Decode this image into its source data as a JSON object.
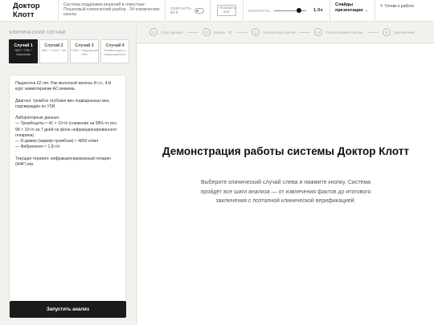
{
  "header": {
    "logo": "Доктор Клотт",
    "subtitle": "Система поддержки решений в гемостазе · Пошаговый клинический разбор · 34 клинические шкалы",
    "collapse_label": "СВЕРНУТЬ ВСЁ",
    "show_all_label": "Показать всё",
    "speed_label": "СКОРОСТЬ",
    "speed_value": "1.0x",
    "speed_fraction": 0.82,
    "slides_label": "Слайды презентации →",
    "ready_plus": "+",
    "ready_label": "Готово к работе"
  },
  "left_panel": {
    "section_title": "КЛИНИЧЕСКИЙ СЛУЧАЙ",
    "cases": [
      {
        "title": "Случай 1",
        "desc": "ПИТ + ТГВ + Онкология",
        "active": true
      },
      {
        "title": "Случай 2",
        "desc": "АВС + ТХЛА + ФВ",
        "active": false
      },
      {
        "title": "Случай 3",
        "desc": "ТЭЛА + Подозрение ЭНО",
        "active": false
      },
      {
        "title": "Случай 4",
        "desc": "Тромбоз аорты у новорожденного",
        "active": false
      }
    ],
    "case_text": {
      "p1": "Пациентка 62 лет. Рак молочной железы III ст., 4-й курс химиотерапии АС-режима.",
      "p2": "Диагноз: тромбоз глубоких вен подвздошных вен, подтверждён по УЗИ.",
      "p3_title": "Лабораторные данные:",
      "p3_l1": "— Тромбоциты ≈ 41 × 10⁹/л (снижение на 58% от исх. 98 × 10⁹/л за 7 дней на фоне нефракционированного гепарина)",
      "p3_l2": "— D-димер (маркёр тромбоза) ≈ 4800 нг/мл",
      "p3_l3": "— Фибриноген ≈ 1.8 г/л",
      "p4": "Текущая терапия: нефракционированный гепарин (НФГ) в/в."
    },
    "run_button": "Запустить анализ"
  },
  "steps": [
    {
      "num": "1",
      "label": "Сбор данных"
    },
    {
      "num": "2",
      "label": "Шкалы · 97"
    },
    {
      "num": "3",
      "label": "Экспертная оценка"
    },
    {
      "num": "4",
      "label": "Согласование тактики"
    },
    {
      "num": "5",
      "label": "Заключение"
    }
  ],
  "main": {
    "title": "Демонстрация работы системы Доктор Клотт",
    "description": "Выберите клинический случай слева и нажмите кнопку. Система пройдёт все шаги анализа — от извлечения фактов до итогового заключения с поэтапной клинической верификацией."
  }
}
